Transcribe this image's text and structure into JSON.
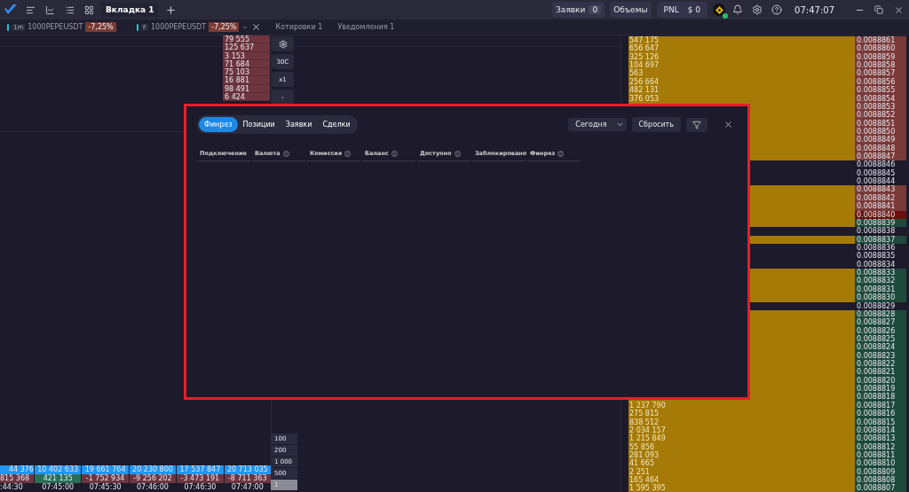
{
  "top_tabs": [
    {
      "label": "Вкладка 1",
      "selected": true
    }
  ],
  "orders": {
    "label": "Заявки",
    "count": "0"
  },
  "volumes_button": "Объемы",
  "pnl": {
    "label": "PNL",
    "value": "$ 0"
  },
  "exchange": {
    "connected": true
  },
  "clock": "07:47:07",
  "panel_tabs": [
    {
      "kind": "chart",
      "interval": "1m",
      "symbol": "1000PEPEUSDT",
      "change": "-7,25%"
    },
    {
      "kind": "ladder",
      "badge": "F",
      "symbol": "1000PEPEUSDT",
      "change": "-7,25%"
    },
    {
      "kind": "plain",
      "title": "Котировки 1"
    },
    {
      "kind": "plain",
      "title": "Уведомления 1"
    }
  ],
  "asks": [
    "79 555",
    "125 637",
    "3 153",
    "71 684",
    "75 103",
    "16 881",
    "98 491",
    "6 424"
  ],
  "side_buttons": [
    "30С",
    "x1",
    "-"
  ],
  "scale_buttons": [
    {
      "label": "100",
      "selected": false
    },
    {
      "label": "200",
      "selected": false
    },
    {
      "label": "1 000",
      "selected": false
    },
    {
      "label": "500",
      "selected": false
    },
    {
      "label": "1",
      "selected": true
    }
  ],
  "cluster": {
    "volumes": [
      "44 376",
      "10 402 633",
      "19 661 764",
      "20 230 800",
      "17 537 847",
      "20 713 035"
    ],
    "deltas": [
      {
        "value": "815 368",
        "kind": "negative"
      },
      {
        "value": "421 135",
        "kind": "positive"
      },
      {
        "value": "-1 752 934",
        "kind": "negative"
      },
      {
        "value": "-9 256 202",
        "kind": "negative"
      },
      {
        "value": "-3 473 191",
        "kind": "negative"
      },
      {
        "value": "-8 711 363",
        "kind": "negative"
      }
    ],
    "times": [
      ":44:30",
      "07:45:00",
      "07:45:30",
      "07:46:00",
      "07:46:30",
      "07:47:00"
    ]
  },
  "ladder": [
    {
      "price": "0.0088861",
      "kind": "ask",
      "bar": true,
      "volume": "547 175"
    },
    {
      "price": "0.0088860",
      "kind": "ask",
      "bar": true,
      "volume": "656 647"
    },
    {
      "price": "0.0088859",
      "kind": "ask",
      "bar": true,
      "volume": "325 126"
    },
    {
      "price": "0.0088858",
      "kind": "ask",
      "bar": true,
      "volume": "104 697"
    },
    {
      "price": "0.0088857",
      "kind": "ask",
      "bar": true,
      "volume": "563"
    },
    {
      "price": "0.0088856",
      "kind": "ask",
      "bar": true,
      "volume": "256 664"
    },
    {
      "price": "0.0088855",
      "kind": "ask",
      "bar": true,
      "volume": "482 131"
    },
    {
      "price": "0.0088854",
      "kind": "ask",
      "bar": true,
      "volume": "376 053"
    },
    {
      "price": "0.0088853",
      "kind": "ask",
      "bar": true
    },
    {
      "price": "0.0088852",
      "kind": "ask",
      "bar": true
    },
    {
      "price": "0.0088851",
      "kind": "ask",
      "bar": true
    },
    {
      "price": "0.0088850",
      "kind": "ask",
      "bar": true
    },
    {
      "price": "0.0088849",
      "kind": "ask",
      "bar": true
    },
    {
      "price": "0.0088848",
      "kind": "ask",
      "bar": true
    },
    {
      "price": "0.0088847",
      "kind": "ask",
      "bar": true
    },
    {
      "price": "0.0088846",
      "kind": "none",
      "bar": false
    },
    {
      "price": "0.0088845",
      "kind": "none",
      "bar": false
    },
    {
      "price": "0.0088844",
      "kind": "none",
      "bar": false
    },
    {
      "price": "0.0088843",
      "kind": "ask",
      "bar": true
    },
    {
      "price": "0.0088842",
      "kind": "ask",
      "bar": true
    },
    {
      "price": "0.0088841",
      "kind": "ask",
      "bar": true
    },
    {
      "price": "0.0088840",
      "kind": "best_ask",
      "bar": true
    },
    {
      "price": "0.0088839",
      "kind": "bid",
      "bar": true
    },
    {
      "price": "0.0088838",
      "kind": "none",
      "bar": false
    },
    {
      "price": "0.0088837",
      "kind": "bid",
      "bar": true
    },
    {
      "price": "0.0088836",
      "kind": "none",
      "bar": false
    },
    {
      "price": "0.0088835",
      "kind": "none",
      "bar": false
    },
    {
      "price": "0.0088834",
      "kind": "none",
      "bar": false
    },
    {
      "price": "0.0088833",
      "kind": "bid",
      "bar": true
    },
    {
      "price": "0.0088832",
      "kind": "bid",
      "bar": true
    },
    {
      "price": "0.0088831",
      "kind": "bid",
      "bar": true
    },
    {
      "price": "0.0088830",
      "kind": "bid",
      "bar": true
    },
    {
      "price": "0.0088829",
      "kind": "none",
      "bar": false
    },
    {
      "price": "0.0088828",
      "kind": "bid",
      "bar": true
    },
    {
      "price": "0.0088827",
      "kind": "bid",
      "bar": true
    },
    {
      "price": "0.0088826",
      "kind": "bid",
      "bar": true
    },
    {
      "price": "0.0088825",
      "kind": "bid",
      "bar": true
    },
    {
      "price": "0.0088824",
      "kind": "bid",
      "bar": true
    },
    {
      "price": "0.0088823",
      "kind": "bid",
      "bar": true
    },
    {
      "price": "0.0088822",
      "kind": "bid",
      "bar": true
    },
    {
      "price": "0.0088821",
      "kind": "bid",
      "bar": true
    },
    {
      "price": "0.0088820",
      "kind": "bid",
      "bar": true
    },
    {
      "price": "0.0088819",
      "kind": "bid",
      "bar": true
    },
    {
      "price": "0.0088818",
      "kind": "bid",
      "bar": true
    },
    {
      "price": "0.0088817",
      "kind": "bid",
      "bar": true,
      "volume": "1 237 790"
    },
    {
      "price": "0.0088816",
      "kind": "bid",
      "bar": true,
      "volume": "275 815"
    },
    {
      "price": "0.0088815",
      "kind": "bid",
      "bar": true,
      "volume": "838 512"
    },
    {
      "price": "0.0088814",
      "kind": "bid",
      "bar": true,
      "volume": "2 034 157"
    },
    {
      "price": "0.0088813",
      "kind": "bid",
      "bar": true,
      "volume": "1 215 849"
    },
    {
      "price": "0.0088812",
      "kind": "bid",
      "bar": true,
      "volume": "55 856"
    },
    {
      "price": "0.0088811",
      "kind": "bid",
      "bar": true,
      "volume": "281 093"
    },
    {
      "price": "0.0088810",
      "kind": "bid",
      "bar": true,
      "volume": "41 665"
    },
    {
      "price": "0.0088809",
      "kind": "bid",
      "bar": true,
      "volume": "2 251"
    },
    {
      "price": "0.0088808",
      "kind": "bid",
      "bar": true,
      "volume": "165 464"
    },
    {
      "price": "0.0088807",
      "kind": "bid",
      "bar": true,
      "volume": "1 595 395"
    }
  ],
  "dialog": {
    "tabs": [
      {
        "label": "Финрез",
        "selected": true
      },
      {
        "label": "Позиции",
        "selected": false
      },
      {
        "label": "Заявки",
        "selected": false
      },
      {
        "label": "Сделки",
        "selected": false
      }
    ],
    "period": "Сегодня",
    "reset_button": "Сбросить",
    "columns": [
      "Подключение",
      "Валюта",
      "Комиссия",
      "Баланс",
      "Доступно",
      "Заблокировано",
      "Финрез"
    ]
  }
}
